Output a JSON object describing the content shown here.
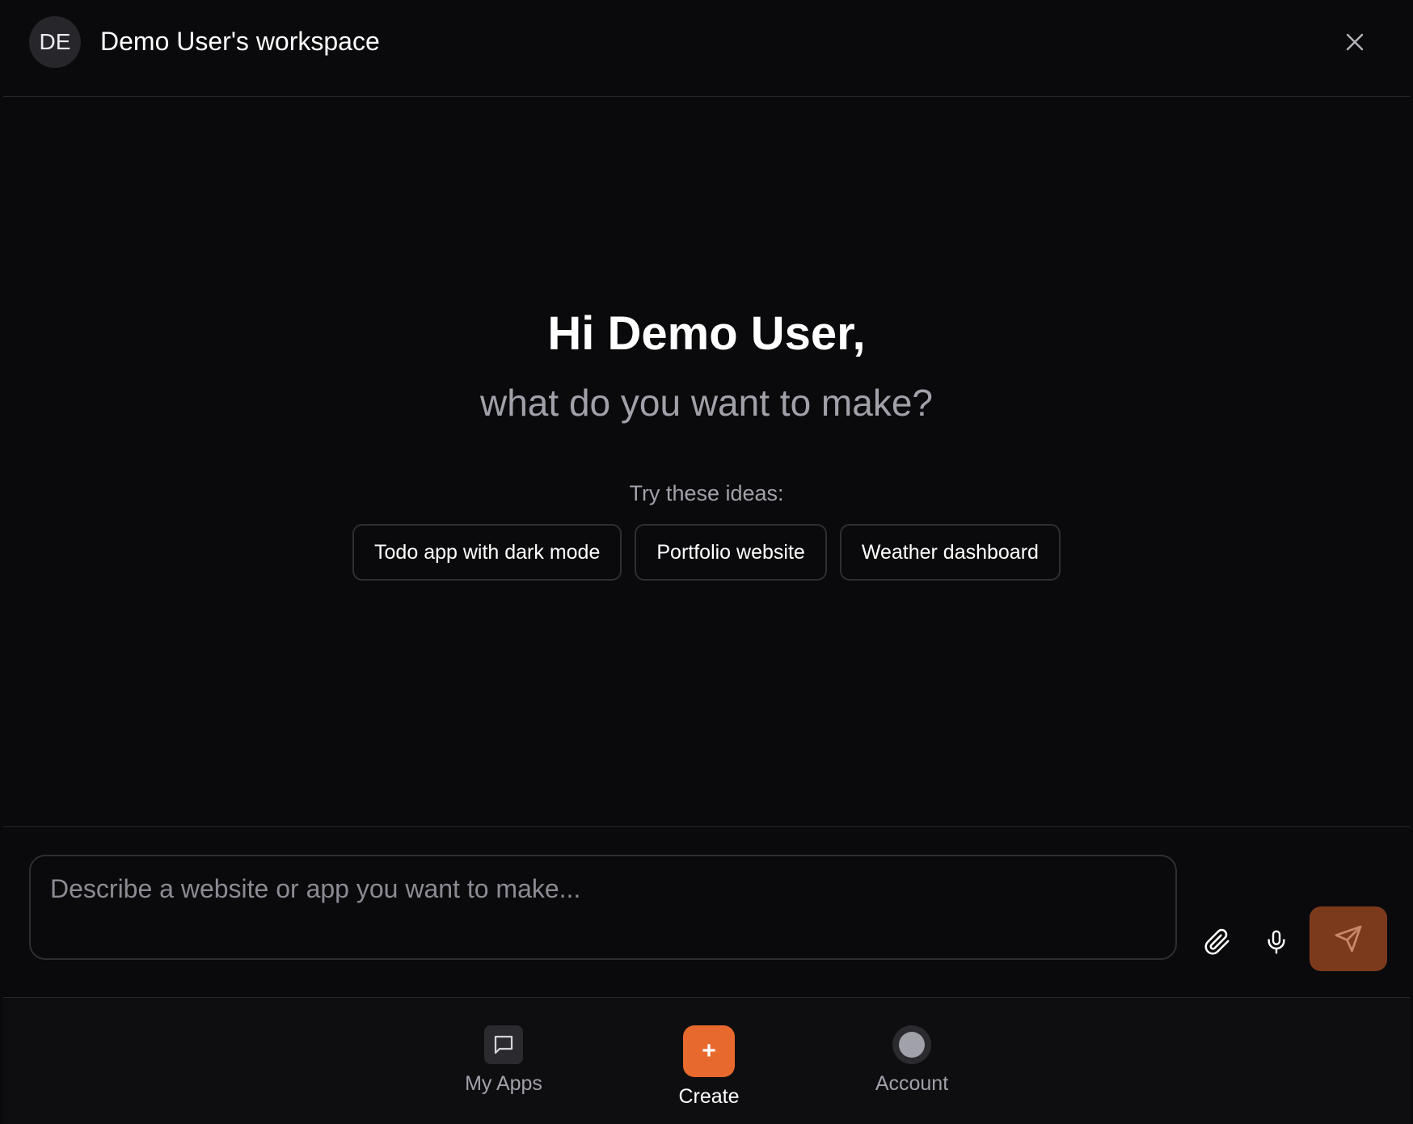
{
  "header": {
    "avatar_initials": "DE",
    "workspace_title": "Demo User's workspace",
    "close_icon": "close-icon"
  },
  "hero": {
    "greeting": "Hi Demo User,",
    "subtitle": "what do you want to make?",
    "ideas_label": "Try these ideas:",
    "ideas": [
      {
        "label": "Todo app with dark mode"
      },
      {
        "label": "Portfolio website"
      },
      {
        "label": "Weather dashboard"
      }
    ]
  },
  "composer": {
    "placeholder": "Describe a website or app you want to make...",
    "value": "",
    "attach_icon": "paperclip-icon",
    "mic_icon": "microphone-icon",
    "send_icon": "send-icon"
  },
  "nav": {
    "items": [
      {
        "label": "My Apps",
        "icon": "chat-bubble-icon",
        "active": false
      },
      {
        "label": "Create",
        "icon": "plus-icon",
        "active": true
      },
      {
        "label": "Account",
        "icon": "account-icon",
        "active": false
      }
    ],
    "create_glyph": "+"
  },
  "colors": {
    "background": "#0a0a0c",
    "accent": "#e8692e",
    "send_button": "#7c3a1c",
    "muted_text": "#a1a1aa",
    "border": "#2e2e33"
  }
}
